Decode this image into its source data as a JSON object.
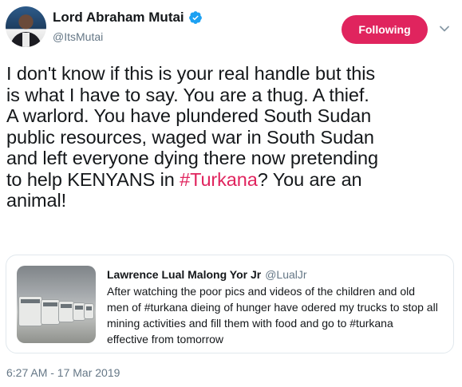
{
  "author": {
    "display_name": "Lord Abraham Mutai",
    "handle": "@ItsMutai",
    "avatar_icon": "profile-avatar",
    "verified_icon": "verified-badge-icon"
  },
  "actions": {
    "follow_label": "Following",
    "menu_icon": "chevron-down-icon"
  },
  "tweet": {
    "lines": [
      "I don't know if this is your real handle but this",
      "is what I have to say. You are a thug. A thief.",
      "A warlord. You have plundered South Sudan",
      "public resources, waged war in South Sudan",
      "and left everyone dying there now pretending"
    ],
    "line6_before": "to help KENYANS in ",
    "hashtag": "#Turkana",
    "line6_after": "? You are an",
    "line7": "animal!"
  },
  "quote": {
    "name": "Lawrence Lual Malong Yor Jr",
    "handle": "@LualJr",
    "lines": [
      "After watching the poor pics and videos of the children and old",
      "men of #turkana dieing of hunger have odered my trucks to stop all",
      "mining activities and fill them with food and go to #turkana",
      "effective from tomorrow"
    ]
  },
  "timestamp": "6:27 AM - 17 Mar 2019",
  "colors": {
    "accent": "#e0245e",
    "verified": "#1da1f2",
    "muted": "#657786",
    "text": "#14171a",
    "border": "#e1e8ed"
  }
}
